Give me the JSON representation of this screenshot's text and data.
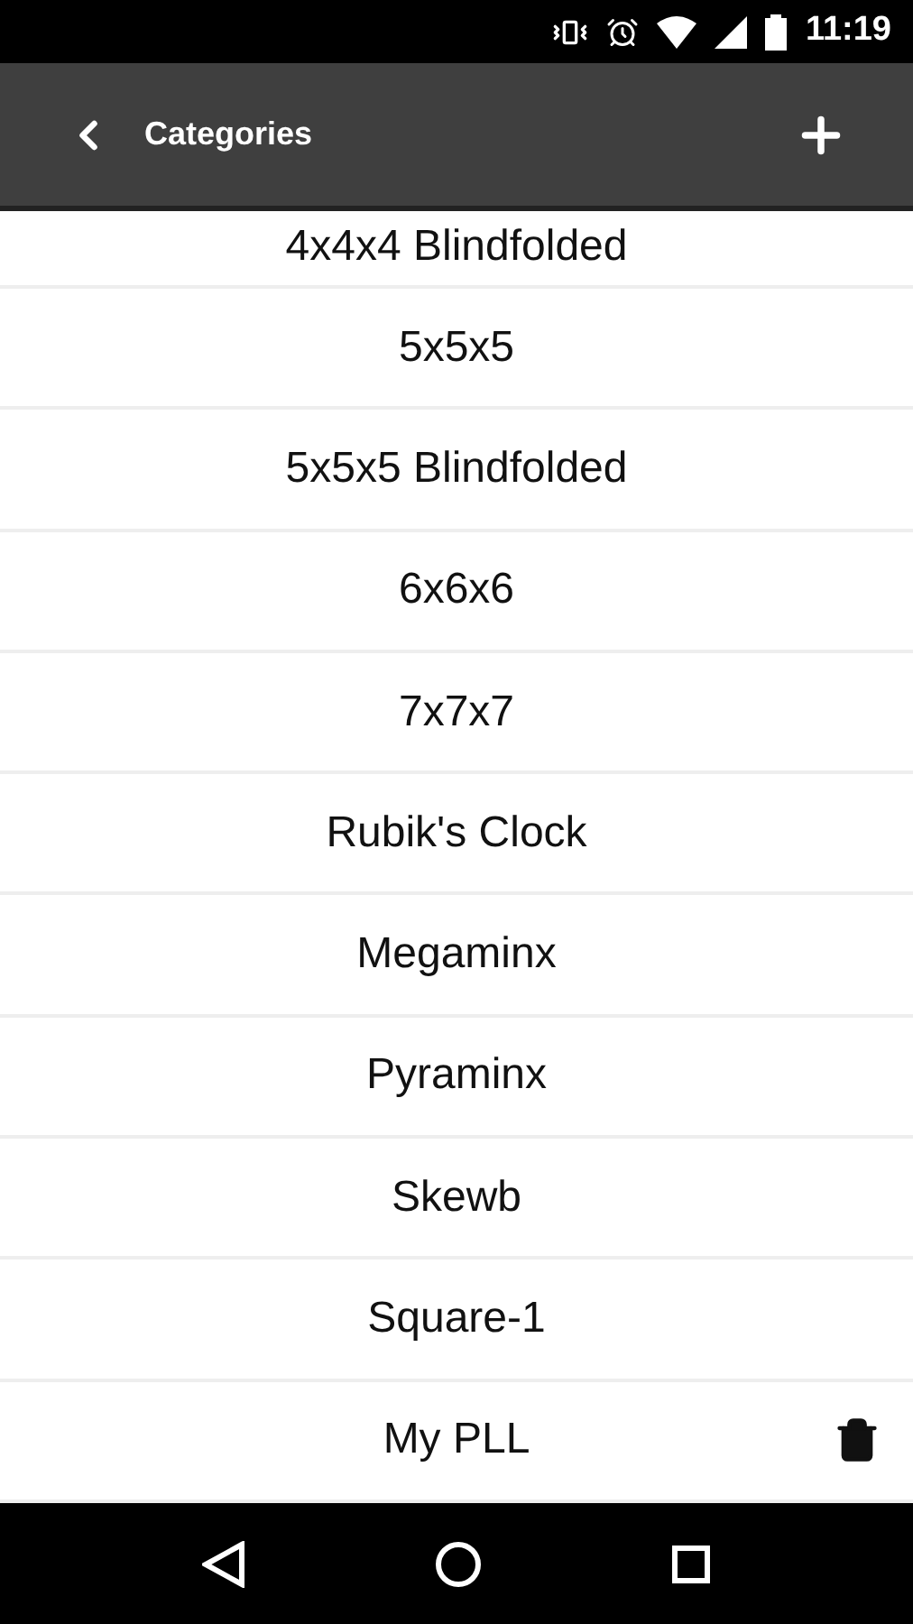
{
  "status_bar": {
    "time": "11:19"
  },
  "toolbar": {
    "title": "Categories"
  },
  "categories": [
    {
      "name": "4x4x4 Blindfolded",
      "deletable": false
    },
    {
      "name": "5x5x5",
      "deletable": false
    },
    {
      "name": "5x5x5 Blindfolded",
      "deletable": false
    },
    {
      "name": "6x6x6",
      "deletable": false
    },
    {
      "name": "7x7x7",
      "deletable": false
    },
    {
      "name": "Rubik's Clock",
      "deletable": false
    },
    {
      "name": "Megaminx",
      "deletable": false
    },
    {
      "name": "Pyraminx",
      "deletable": false
    },
    {
      "name": "Skewb",
      "deletable": false
    },
    {
      "name": "Square-1",
      "deletable": false
    },
    {
      "name": "My PLL",
      "deletable": true
    }
  ]
}
